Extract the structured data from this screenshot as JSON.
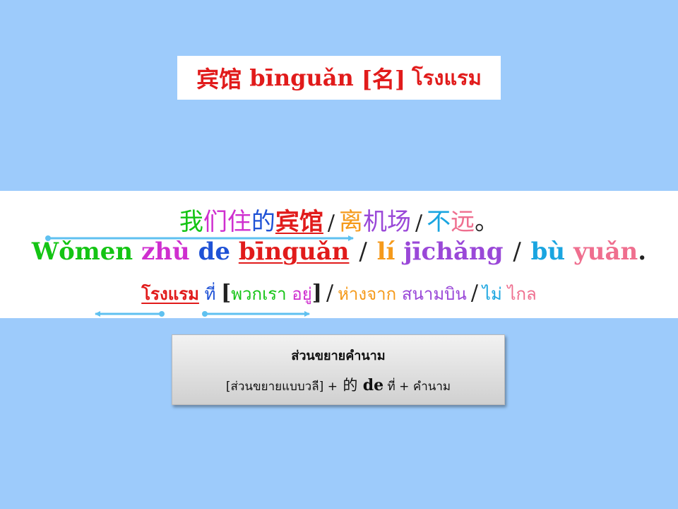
{
  "background_color": "#9dcbfb",
  "title": {
    "hanzi": "宾馆",
    "pinyin": "bīnguǎn",
    "pos": "[名]",
    "thai": "โรงแรม",
    "color": "#e11b1b"
  },
  "hanzi_line": {
    "seg1": [
      "我",
      "们",
      "住",
      "的",
      "宾馆"
    ],
    "seg2": [
      "离",
      "机",
      "场"
    ],
    "seg3": [
      "不",
      "远"
    ],
    "period": "。",
    "slash": "/"
  },
  "pinyin_line": {
    "women": "Wǒmen",
    "zhu": "zhù",
    "de": "de",
    "binguan": "bīnguǎn",
    "li": "lí",
    "jichang": "jīchǎng",
    "bu": "bù",
    "yuan": "yuǎn",
    "period": ".",
    "slash": "/"
  },
  "thai_line": {
    "hotel": "โรงแรม",
    "that": "ที่",
    "open_bracket": "[",
    "we": "พวกเรา",
    "stay": "อยู่",
    "close_bracket": "]",
    "far_from": "ห่างจาก",
    "airport": "สนามบิน",
    "not": "ไม่",
    "far": "ไกล",
    "slash": "/"
  },
  "note": {
    "heading": "ส่วนขยายคำนาม",
    "formula_part1": "[ส่วนขยายแบบวลี]",
    "plus1": "+",
    "de_hanzi": "的",
    "de_pinyin": "de",
    "that": "ที่",
    "plus2": "+",
    "noun": "คำนาม"
  },
  "colors": {
    "green": "#14c414",
    "magenta": "#cf2fcf",
    "blue": "#1f52d6",
    "red": "#e11b1b",
    "orange": "#f59a1b",
    "purple": "#9a48d8",
    "cyan": "#1aa5e0",
    "pink": "#ef6f8f",
    "arrow": "#5fc1f0"
  }
}
